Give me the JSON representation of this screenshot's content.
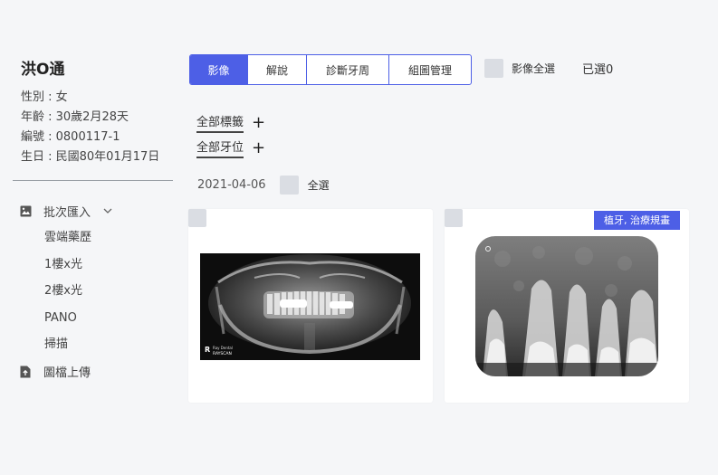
{
  "patient": {
    "name": "洪O通",
    "gender": "性別 : 女",
    "age": "年齡 : 30歲2月28天",
    "id": "編號 : 0800117-1",
    "birthday": "生日 : 民國80年01月17日"
  },
  "nav": {
    "batch_import": "批次匯入",
    "sub_items": [
      "雲端藥歷",
      "1樓x光",
      "2樓x光",
      "PANO",
      "掃描"
    ],
    "file_upload": "圖檔上傳"
  },
  "tabs": [
    "影像",
    "解說",
    "診斷牙周",
    "組圖管理"
  ],
  "active_tab": "影像",
  "select_all_images": "影像全選",
  "selected_count": "已選0",
  "filters": {
    "all_tags": "全部標籤",
    "all_teeth": "全部牙位",
    "add_symbol": "+"
  },
  "date_group": {
    "date": "2021-04-06",
    "select_all": "全選"
  },
  "cards": [
    {
      "tag": ""
    },
    {
      "tag": "植牙, 治療規畫"
    }
  ],
  "pano_watermark": {
    "brand": "Ray Dental",
    "product": "RAYSCAN"
  },
  "colors": {
    "accent": "#4d5fe6",
    "checkbox": "#dadde3",
    "background": "#f5f6f8"
  },
  "icons": {
    "batch_import": "image-icon",
    "expand": "chevron-down-icon",
    "upload": "file-upload-icon"
  }
}
